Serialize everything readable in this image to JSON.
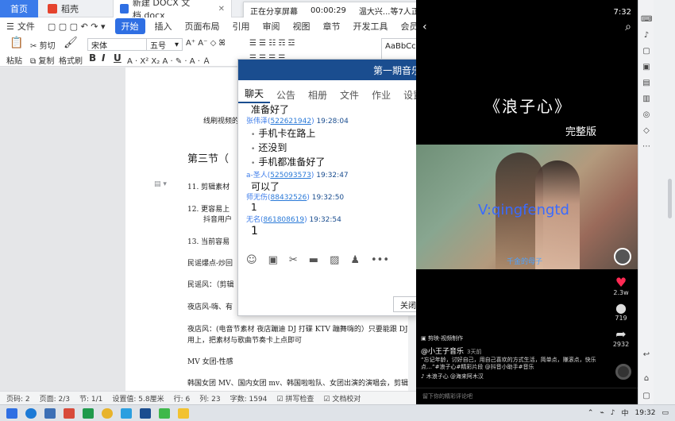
{
  "tabs": [
    {
      "label": "首页"
    },
    {
      "label": "稻壳"
    },
    {
      "label": "新建 DOCX 文档.docx"
    }
  ],
  "share_bar": {
    "status": "正在分享屏幕",
    "elapsed": "00:00:29",
    "viewers": "温大兴...等7人正在观看"
  },
  "menu": {
    "file": "文件",
    "items": [
      "开始",
      "插入",
      "页面布局",
      "引用",
      "审阅",
      "视图",
      "章节",
      "开发工具",
      "会员专享"
    ]
  },
  "ribbon": {
    "paste": "粘贴",
    "cut": "剪切",
    "copy": "复制",
    "format_painter": "格式刷",
    "font_name": "宋体",
    "font_size": "五号",
    "style_preview": "AaBbCcDd"
  },
  "document": {
    "lines": [
      "线刷视频的",
      "第三节（",
      "11.  剪辑素材",
      "12.  更容易上",
      "抖音用户",
      "13.  当前容易",
      "民谣爆点-炒回",
      "民谣风：（剪辑",
      "夜店风-嗨、有",
      "夜店风：(电音节素材 夜店蹦迪 DJ 打碟 KTV 蹦舞嗨的）只要能跟 DJ 嗨",
      "用上，把素材与歌曲节奏卡上点即可",
      "MV 女团-性感",
      "韩国女团 MV、国内女团 mv、韩国啦啦队、女团出演的演唱会，剪辑：把"
    ]
  },
  "status_bar": {
    "page_code": "页码: 2",
    "pages": "页面: 2/3",
    "section": "节: 1/1",
    "setting": "设置值: 5.8厘米",
    "row": "行: 6",
    "col": "列: 23",
    "word_count": "字数: 1594",
    "spell_check": "拼写检查",
    "doc_proof": "文档校对"
  },
  "chat": {
    "title": "第一期音乐",
    "tabs": [
      "聊天",
      "公告",
      "相册",
      "文件",
      "作业",
      "设置"
    ],
    "messages": [
      {
        "type": "text",
        "text": "准备好了"
      },
      {
        "type": "head",
        "name": "张伟泽(",
        "qq": "522621942",
        "close": ")",
        "time": "19:28:04"
      },
      {
        "type": "text",
        "text": "手机卡在路上"
      },
      {
        "type": "text",
        "text": "还没到"
      },
      {
        "type": "text",
        "text": "手机都准备好了"
      },
      {
        "type": "head",
        "name": "a-圣人(",
        "qq": "525093573",
        "close": ")",
        "time": "19:32:47"
      },
      {
        "type": "text",
        "text": "可以了"
      },
      {
        "type": "head",
        "name": "师无伤(",
        "qq": "88432526",
        "close": ")",
        "time": "19:32:50"
      },
      {
        "type": "text",
        "text": "1"
      },
      {
        "type": "head",
        "name": "无名(",
        "qq": "861808619",
        "close": ")",
        "time": "19:32:54"
      },
      {
        "type": "text",
        "text": "1"
      }
    ],
    "close_label": "关闭"
  },
  "phone": {
    "time": "7:32",
    "song_title": "《浪子心》",
    "song_sub": "完整版",
    "watermark": "V:qingfengtd",
    "subtitle": "千金的母子",
    "likes": "2.3w",
    "comments": "719",
    "shares": "2932",
    "tag": "剪映·视频制作",
    "author": "@小王子音乐",
    "author_days": "3天前",
    "desc_line1": "“忘记年龄，讨好自己，用自己喜欢的方式生活，简单点，赚滚点，快乐",
    "desc_line2": "点…”#浪子心#精彩片段 @抖音小助手#音乐",
    "music": "♪ 木浪子心  @海来阿木汉",
    "comment_placeholder": "留下你的精彩评论吧"
  },
  "taskbar": {
    "tray_ime": "中",
    "tray_time": "19:32"
  }
}
